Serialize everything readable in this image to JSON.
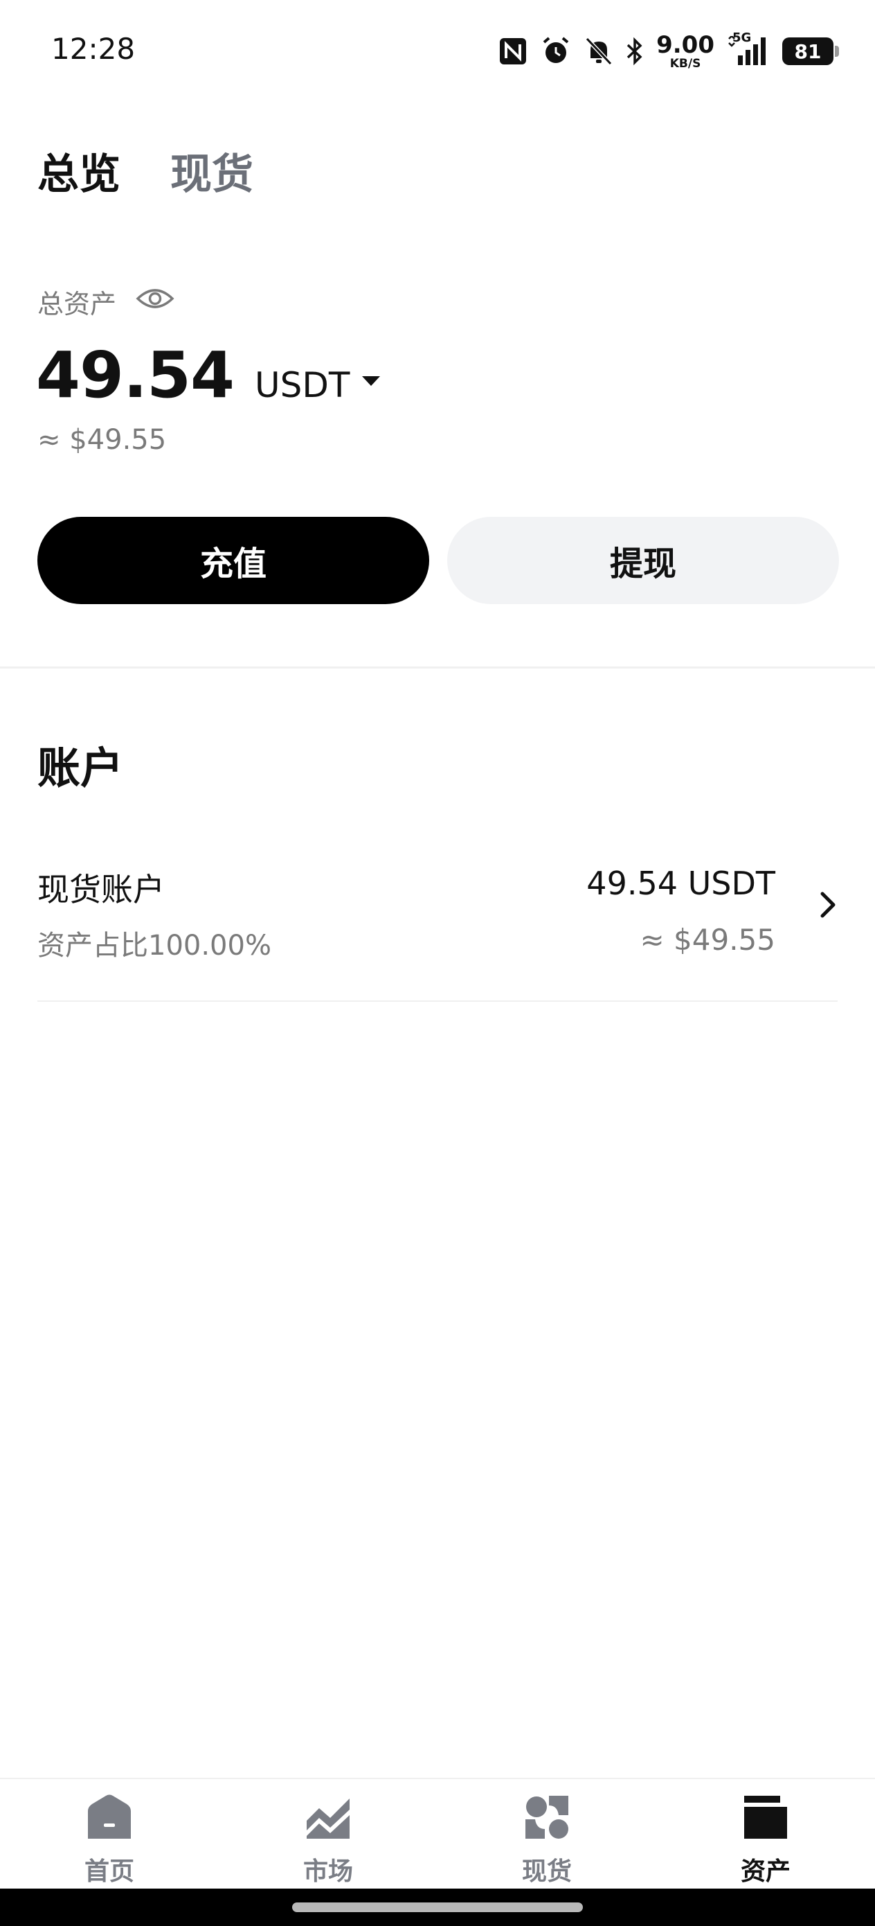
{
  "status_bar": {
    "time": "12:28",
    "net_speed_value": "9.00",
    "net_speed_unit": "KB/S",
    "network_type": "5G",
    "battery": "81",
    "icons": [
      "nfc-icon",
      "alarm-icon",
      "bell-off-icon",
      "bluetooth-icon",
      "signal-icon",
      "battery-icon"
    ]
  },
  "tabs": [
    {
      "label": "总览",
      "active": true
    },
    {
      "label": "现货",
      "active": false
    }
  ],
  "assets": {
    "label": "总资产",
    "balance": "49.54",
    "currency": "USDT",
    "approx_usd": "≈ $49.55"
  },
  "actions": {
    "deposit_label": "充值",
    "withdraw_label": "提现"
  },
  "accounts": {
    "title": "账户",
    "items": [
      {
        "name": "现货账户",
        "share": "资产占比100.00%",
        "value": "49.54 USDT",
        "approx_usd": "≈ $49.55"
      }
    ]
  },
  "bottom_nav": [
    {
      "label": "首页",
      "icon": "home-icon",
      "active": false
    },
    {
      "label": "市场",
      "icon": "market-chart-icon",
      "active": false
    },
    {
      "label": "现货",
      "icon": "spot-icon",
      "active": false
    },
    {
      "label": "资产",
      "icon": "wallet-icon",
      "active": true
    }
  ],
  "colors": {
    "primary_text": "#111111",
    "secondary_text": "#7a7a7a",
    "deposit_bg": "#000000",
    "withdraw_bg": "#f2f3f5",
    "inactive_nav": "#7a7d85"
  }
}
